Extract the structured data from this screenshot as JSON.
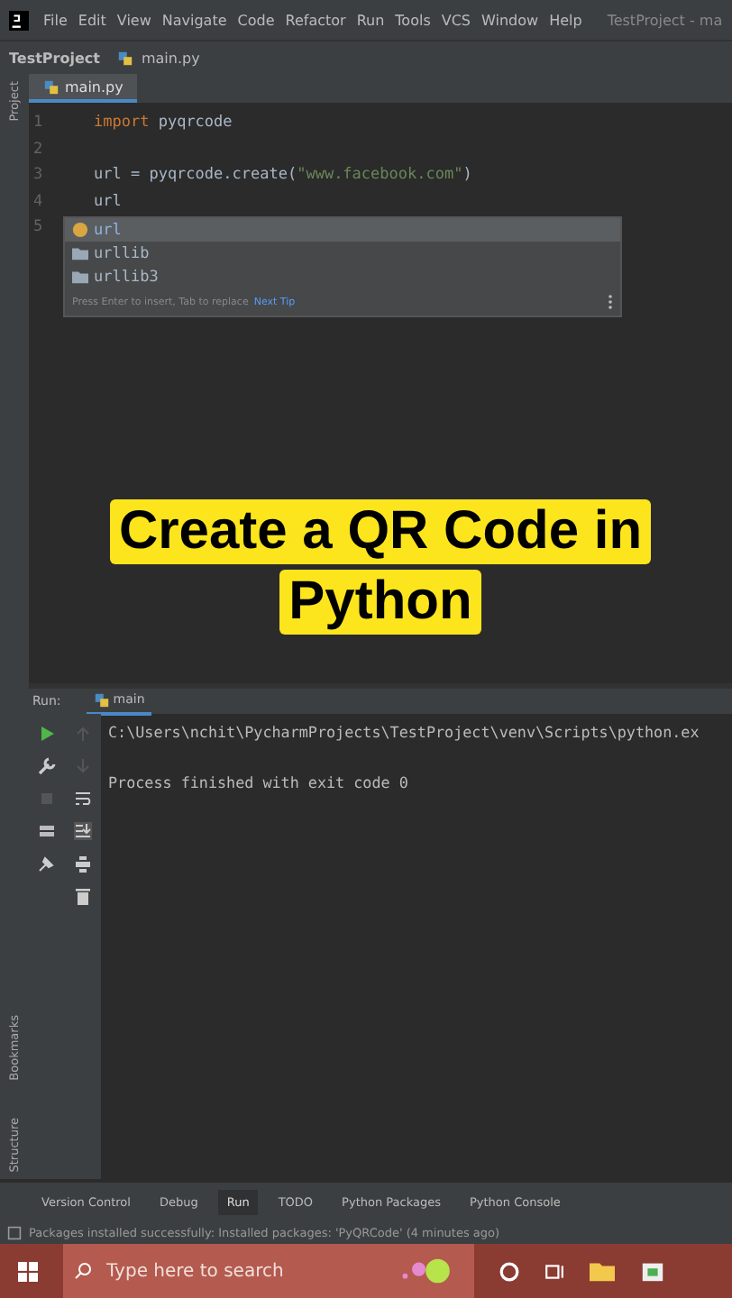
{
  "menu": {
    "items": [
      "File",
      "Edit",
      "View",
      "Navigate",
      "Code",
      "Refactor",
      "Run",
      "Tools",
      "VCS",
      "Window",
      "Help"
    ],
    "title": "TestProject - ma"
  },
  "breadcrumb": [
    "TestProject",
    "main.py"
  ],
  "left_strip": [
    "Project",
    "Bookmarks",
    "Structure"
  ],
  "editor_tabs": [
    {
      "label": "main.py",
      "selected": true
    }
  ],
  "code_lines": [
    {
      "number": "1",
      "tokens": [
        {
          "kind": "keyword",
          "text": "import"
        },
        {
          "kind": "plain",
          "text": " pyqrcode"
        }
      ]
    },
    {
      "number": "2"
    },
    {
      "number": "3",
      "tokens": [
        {
          "kind": "plain",
          "text": "url = pyqrcode.create("
        },
        {
          "kind": "string",
          "text": "\"www.facebook.com\""
        },
        {
          "kind": "plain",
          "text": ")"
        }
      ]
    },
    {
      "number": "4",
      "tokens": [
        {
          "kind": "plain",
          "text": "url"
        }
      ]
    },
    {
      "number": "5"
    }
  ],
  "completion": {
    "items": [
      {
        "label": "url",
        "kind": "variable",
        "selected": true
      },
      {
        "label": "urllib",
        "kind": "package",
        "selected": false
      },
      {
        "label": "urllib3",
        "kind": "package",
        "selected": false
      }
    ],
    "hint": "Press Enter to insert, Tab to replace",
    "tip_link": "Next Tip"
  },
  "caption": [
    "Create a QR Code in",
    "Python"
  ],
  "run_panel": {
    "label": "Run:",
    "tabs": [
      {
        "label": "main",
        "selected": true
      }
    ],
    "output": [
      "C:\\Users\\nchit\\PycharmProjects\\TestProject\\venv\\Scripts\\python.ex",
      "Process finished with exit code 0"
    ]
  },
  "tool_tabs": [
    {
      "label": "Version Control",
      "selected": false
    },
    {
      "label": "Debug",
      "selected": false
    },
    {
      "label": "Run",
      "selected": true
    },
    {
      "label": "TODO",
      "selected": false
    },
    {
      "label": "Python Packages",
      "selected": false
    },
    {
      "label": "Python Console",
      "selected": false
    }
  ],
  "status_bar": "Packages installed successfully: Installed packages: 'PyQRCode' (4 minutes ago)",
  "taskbar": {
    "search": {
      "placeholder": "Type here to search"
    }
  }
}
